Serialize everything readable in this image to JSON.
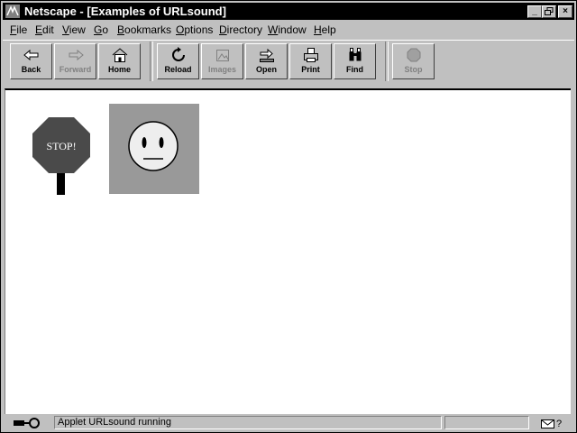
{
  "window": {
    "title": "Netscape - [Examples of URLsound]"
  },
  "menu": [
    {
      "key": "F",
      "rest": "ile"
    },
    {
      "key": "E",
      "rest": "dit"
    },
    {
      "key": "V",
      "rest": "iew"
    },
    {
      "key": "G",
      "rest": "o"
    },
    {
      "key": "B",
      "rest": "ookmarks"
    },
    {
      "key": "O",
      "rest": "ptions"
    },
    {
      "key": "D",
      "rest": "irectory"
    },
    {
      "key": "W",
      "rest": "indow"
    },
    {
      "key": "H",
      "rest": "elp"
    }
  ],
  "toolbar": {
    "back": "Back",
    "forward": "Forward",
    "home": "Home",
    "reload": "Reload",
    "images": "Images",
    "open": "Open",
    "print": "Print",
    "find": "Find",
    "stop": "Stop"
  },
  "content": {
    "stop_sign_text": "STOP!"
  },
  "status": {
    "message": "Applet URLsound running"
  },
  "colors": {
    "titlebar": "#000000",
    "chrome": "#c0c0c0",
    "content_bg": "#ffffff",
    "stop_sign": "#4a4a4a",
    "face_box": "#999999",
    "face": "#eeeeee"
  },
  "icons": [
    "netscape-icon",
    "minimize-icon",
    "restore-icon",
    "close-icon",
    "back-icon",
    "forward-icon",
    "home-icon",
    "reload-icon",
    "images-icon",
    "open-icon",
    "print-icon",
    "find-icon",
    "stop-icon",
    "security-key-icon",
    "mail-icon"
  ]
}
